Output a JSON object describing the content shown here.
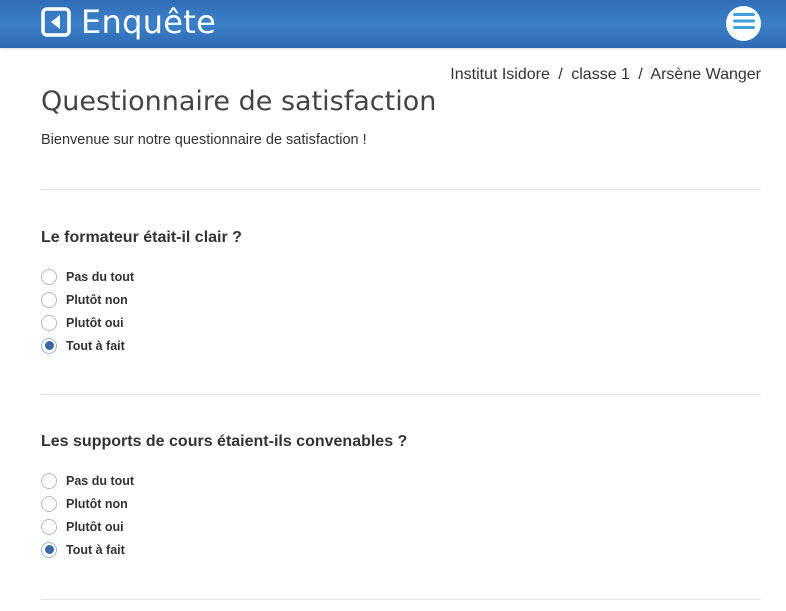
{
  "header": {
    "title": "Enquête",
    "logo_icon": "back-arrow-square-icon",
    "menu_icon": "hamburger-menu-icon",
    "brand_color": "#2f6fb8"
  },
  "breadcrumb": {
    "institution": "Institut Isidore",
    "class": "classe 1",
    "person": "Arsène Wanger",
    "separator": "/"
  },
  "page": {
    "title": "Questionnaire de satisfaction",
    "intro": "Bienvenue sur notre questionnaire de satisfaction !"
  },
  "questions": [
    {
      "title": "Le formateur était-il clair ?",
      "options": [
        {
          "label": "Pas du tout",
          "checked": false
        },
        {
          "label": "Plutôt non",
          "checked": false
        },
        {
          "label": "Plutôt oui",
          "checked": false
        },
        {
          "label": "Tout à fait",
          "checked": true
        }
      ]
    },
    {
      "title": "Les supports de cours étaient-ils convenables ?",
      "options": [
        {
          "label": "Pas du tout",
          "checked": false
        },
        {
          "label": "Plutôt non",
          "checked": false
        },
        {
          "label": "Plutôt oui",
          "checked": false
        },
        {
          "label": "Tout à fait",
          "checked": true
        }
      ]
    }
  ],
  "colors": {
    "accent": "#3a69a6",
    "divider": "#e5e5e5"
  }
}
